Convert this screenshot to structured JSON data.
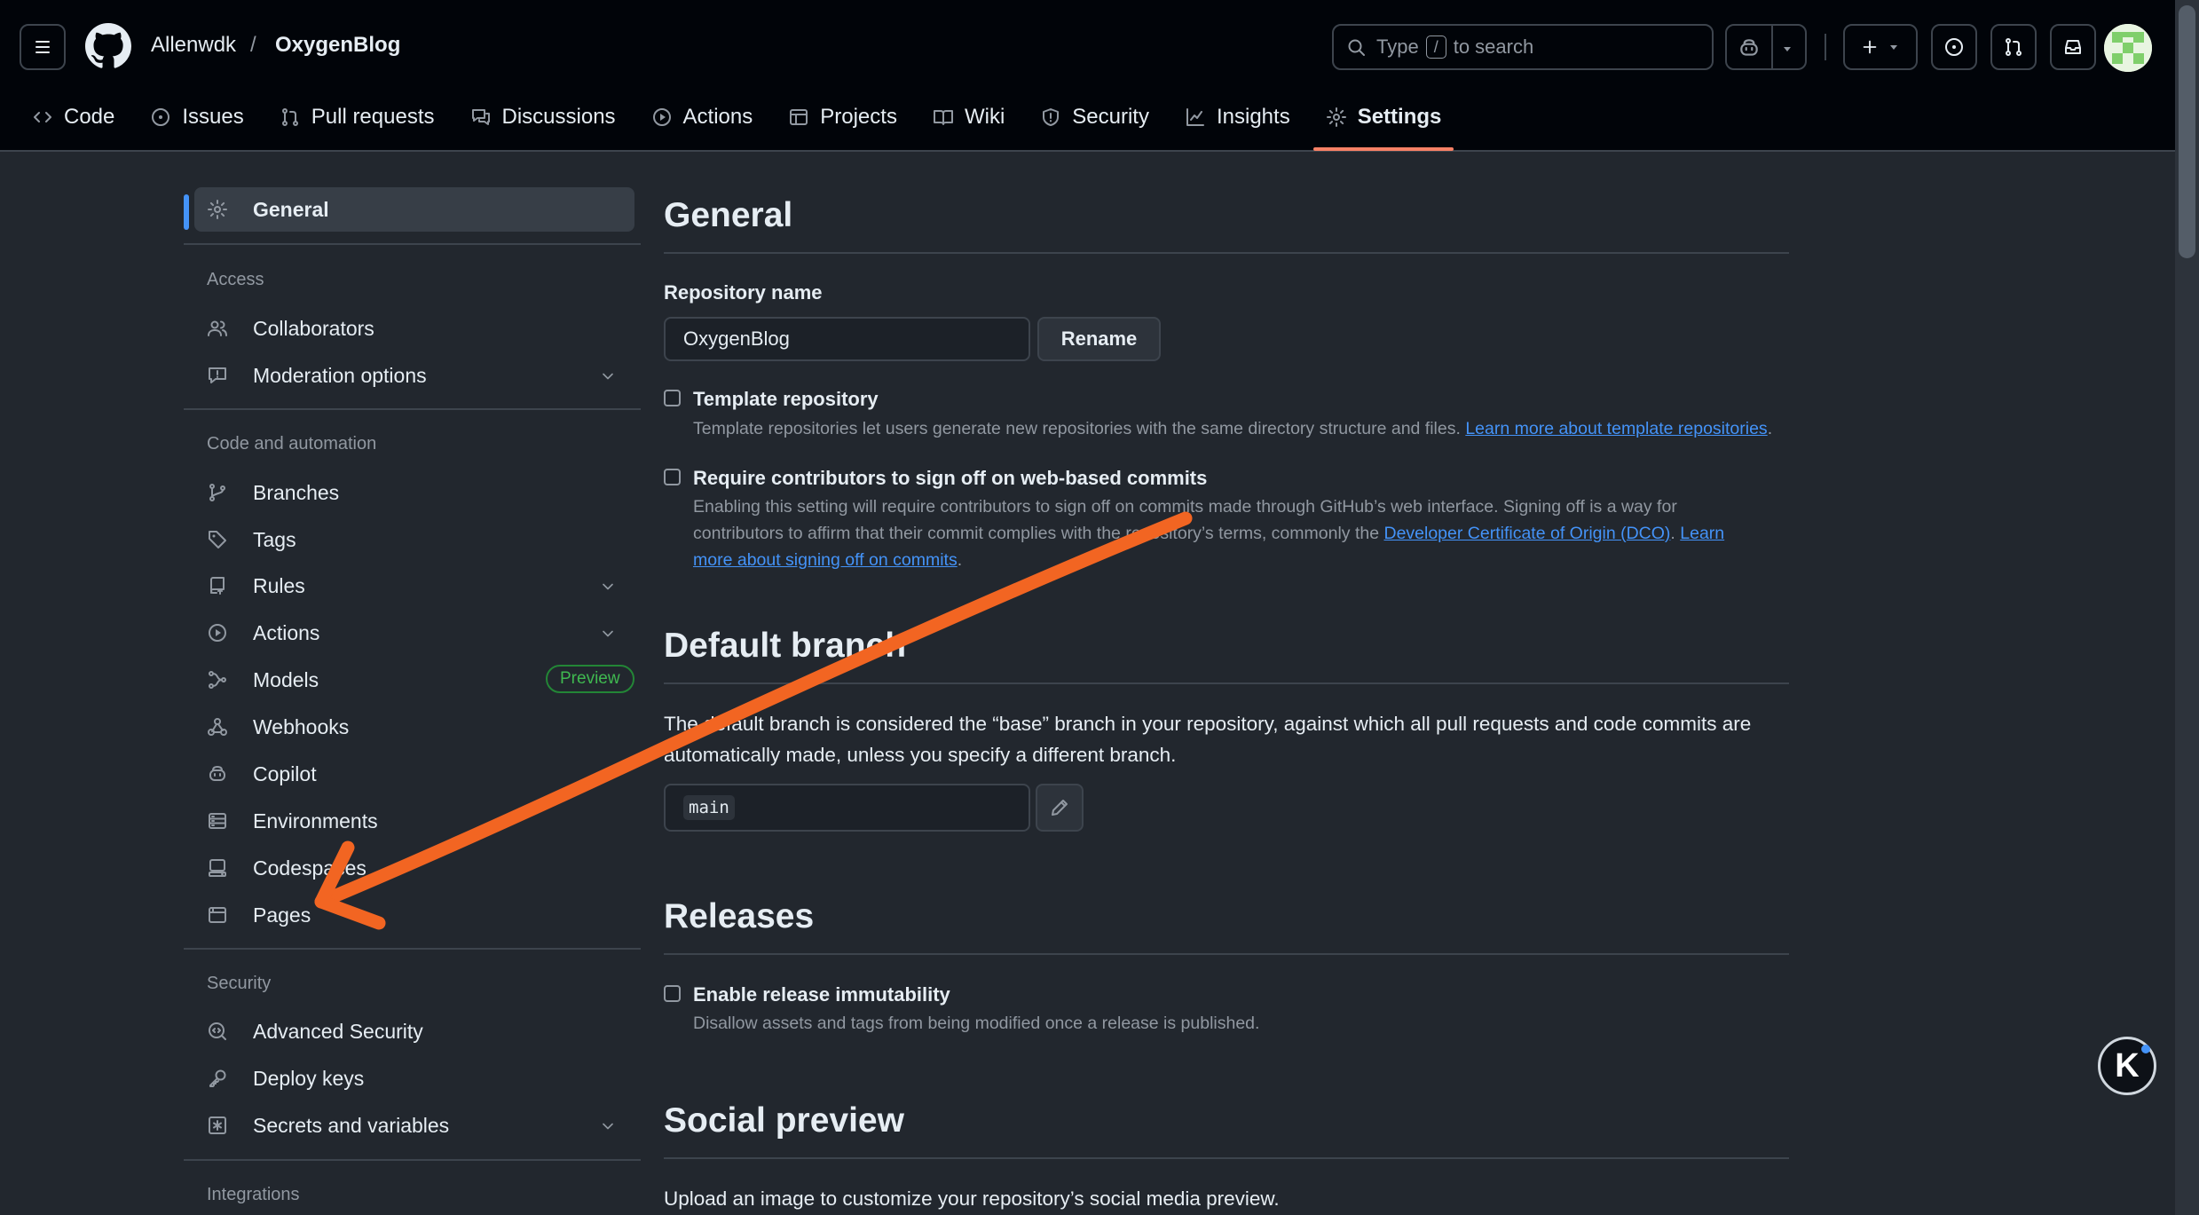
{
  "header": {
    "owner": "Allenwdk",
    "separator": "/",
    "repo": "OxygenBlog",
    "search": {
      "prefix": "Type",
      "key": "/",
      "suffix": "to search"
    }
  },
  "repo_nav": {
    "tabs": [
      {
        "label": "Code",
        "icon": "code-icon"
      },
      {
        "label": "Issues",
        "icon": "issue-opened-icon"
      },
      {
        "label": "Pull requests",
        "icon": "git-pull-request-icon"
      },
      {
        "label": "Discussions",
        "icon": "comment-discussion-icon"
      },
      {
        "label": "Actions",
        "icon": "play-icon"
      },
      {
        "label": "Projects",
        "icon": "table-icon"
      },
      {
        "label": "Wiki",
        "icon": "book-icon"
      },
      {
        "label": "Security",
        "icon": "shield-icon"
      },
      {
        "label": "Insights",
        "icon": "graph-icon"
      },
      {
        "label": "Settings",
        "icon": "gear-icon",
        "active": true
      }
    ]
  },
  "sidebar": {
    "general": "General",
    "access_heading": "Access",
    "access": [
      {
        "label": "Collaborators",
        "icon": "people-icon"
      },
      {
        "label": "Moderation options",
        "icon": "report-icon",
        "expandable": true
      }
    ],
    "code_heading": "Code and automation",
    "code": [
      {
        "label": "Branches",
        "icon": "git-branch-icon"
      },
      {
        "label": "Tags",
        "icon": "tag-icon"
      },
      {
        "label": "Rules",
        "icon": "repo-push-icon",
        "expandable": true
      },
      {
        "label": "Actions",
        "icon": "play-icon",
        "expandable": true
      },
      {
        "label": "Models",
        "icon": "workflow-icon",
        "badge": "Preview"
      },
      {
        "label": "Webhooks",
        "icon": "webhook-icon"
      },
      {
        "label": "Copilot",
        "icon": "copilot-icon"
      },
      {
        "label": "Environments",
        "icon": "server-icon"
      },
      {
        "label": "Codespaces",
        "icon": "codespaces-icon"
      },
      {
        "label": "Pages",
        "icon": "browser-icon"
      }
    ],
    "security_heading": "Security",
    "security": [
      {
        "label": "Advanced Security",
        "icon": "codescan-icon"
      },
      {
        "label": "Deploy keys",
        "icon": "key-icon"
      },
      {
        "label": "Secrets and variables",
        "icon": "key-asterisk-icon",
        "expandable": true
      }
    ],
    "integrations_heading": "Integrations"
  },
  "main": {
    "title": "General",
    "repo_name_label": "Repository name",
    "repo_name_value": "OxygenBlog",
    "rename_label": "Rename",
    "template": {
      "label": "Template repository",
      "desc": "Template repositories let users generate new repositories with the same directory structure and files.",
      "link": "Learn more about template repositories",
      "end": ".",
      "checked": false
    },
    "signoff": {
      "label": "Require contributors to sign off on web-based commits",
      "desc_1": "Enabling this setting will require contributors to sign off on commits made through GitHub’s web interface. Signing off is a way for",
      "desc_2": "contributors to affirm that their commit complies with the repository’s terms, commonly the",
      "link_1": "Developer Certificate of Origin (DCO)",
      "mid": ".",
      "link_2a": "Learn",
      "link_2b": "more about signing off on commits",
      "end": ".",
      "checked": false
    },
    "default_branch": {
      "title": "Default branch",
      "desc_1": "The default branch is considered the “base” branch in your repository, against which all pull requests and code commits are",
      "desc_2": "automatically made, unless you specify a different branch.",
      "value": "main"
    },
    "releases": {
      "title": "Releases",
      "label": "Enable release immutability",
      "desc": "Disallow assets and tags from being modified once a release is published.",
      "checked": false
    },
    "social": {
      "title": "Social preview",
      "desc": "Upload an image to customize your repository’s social media preview."
    }
  },
  "overlay": {
    "k_button": "K",
    "arrow_color": "#f26522"
  },
  "colors": {
    "accent": "#4493f8",
    "active_tab": "#f78166",
    "preview_badge": "#3fb950"
  }
}
